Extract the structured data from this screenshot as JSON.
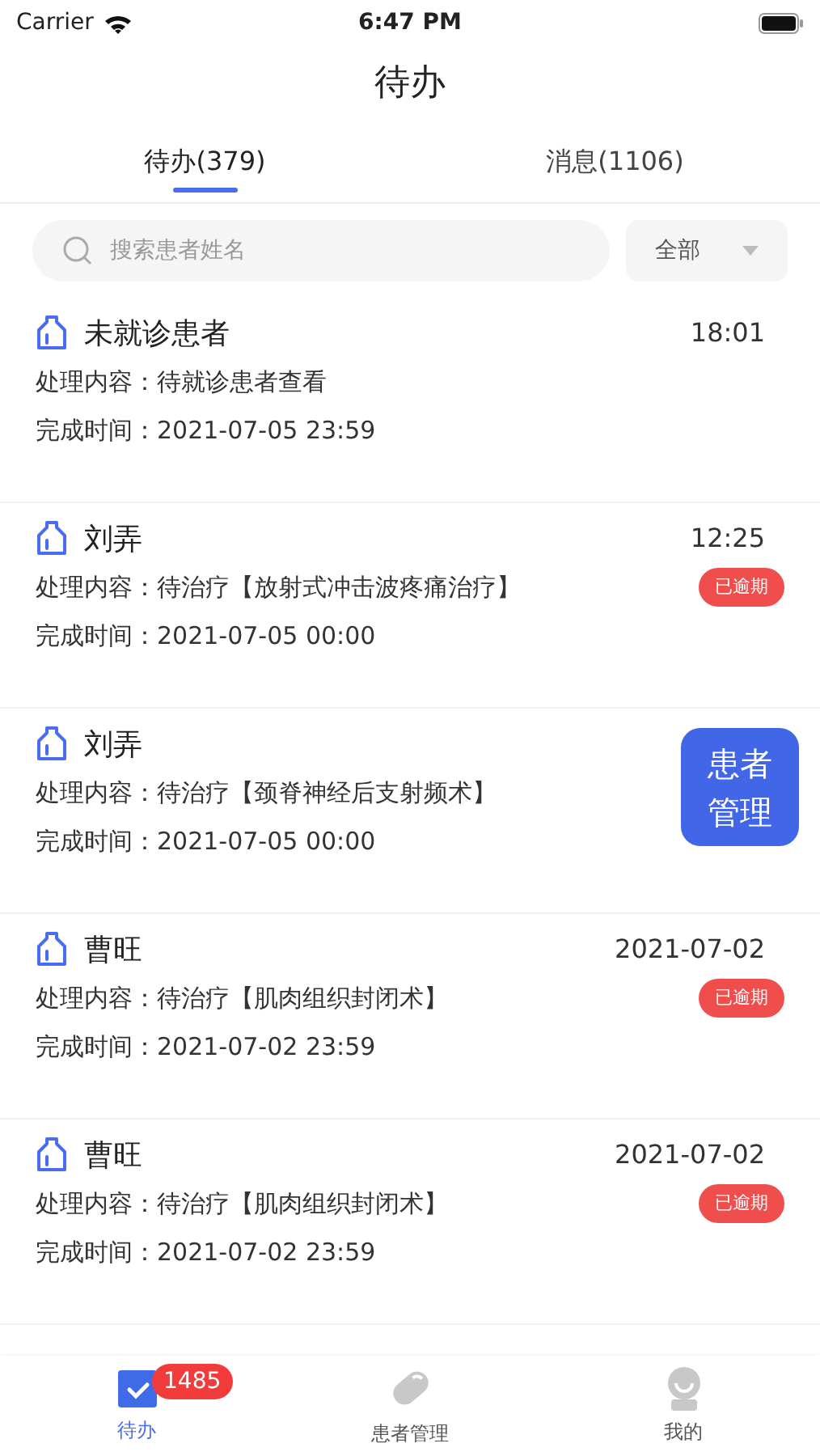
{
  "status_bar": {
    "carrier": "Carrier",
    "time": "6:47 PM"
  },
  "title": "待办",
  "tabs": [
    {
      "label": "待办(379)",
      "selected": true
    },
    {
      "label": "消息(1106)",
      "selected": false
    }
  ],
  "search": {
    "placeholder": "搜索患者姓名"
  },
  "filter": {
    "value": "全部"
  },
  "items": [
    {
      "name": "未就诊患者",
      "time": "18:01",
      "content_label": "处理内容：",
      "content": "待就诊患者查看",
      "done_label": "完成时间：",
      "done_time": "2021-07-05 23:59",
      "overdue": false
    },
    {
      "name": "刘弄",
      "time": "12:25",
      "content_label": "处理内容：",
      "content": "待治疗【放射式冲击波疼痛治疗】",
      "done_label": "完成时间：",
      "done_time": "2021-07-05 00:00",
      "overdue": true,
      "overdue_label": "已逾期"
    },
    {
      "name": "刘弄",
      "content_label": "处理内容：",
      "content": "待治疗【颈脊神经后支射频术】",
      "done_label": "完成时间：",
      "done_time": "2021-07-05 00:00",
      "overdue": false
    },
    {
      "name": "曹旺",
      "time": "2021-07-02",
      "content_label": "处理内容：",
      "content": "待治疗【肌肉组织封闭术】",
      "done_label": "完成时间：",
      "done_time": "2021-07-02 23:59",
      "overdue": true,
      "overdue_label": "已逾期"
    },
    {
      "name": "曹旺",
      "time": "2021-07-02",
      "content_label": "处理内容：",
      "content": "待治疗【肌肉组织封闭术】",
      "done_label": "完成时间：",
      "done_time": "2021-07-02 23:59",
      "overdue": true,
      "overdue_label": "已逾期"
    }
  ],
  "floating_button": {
    "lines": [
      "患者",
      "管理"
    ]
  },
  "bottom_tabs": [
    {
      "kind": "todo",
      "label": "待办",
      "selected": true,
      "badge": "1485"
    },
    {
      "kind": "pill",
      "label": "患者管理",
      "selected": false
    },
    {
      "kind": "user",
      "label": "我的",
      "selected": false
    }
  ]
}
